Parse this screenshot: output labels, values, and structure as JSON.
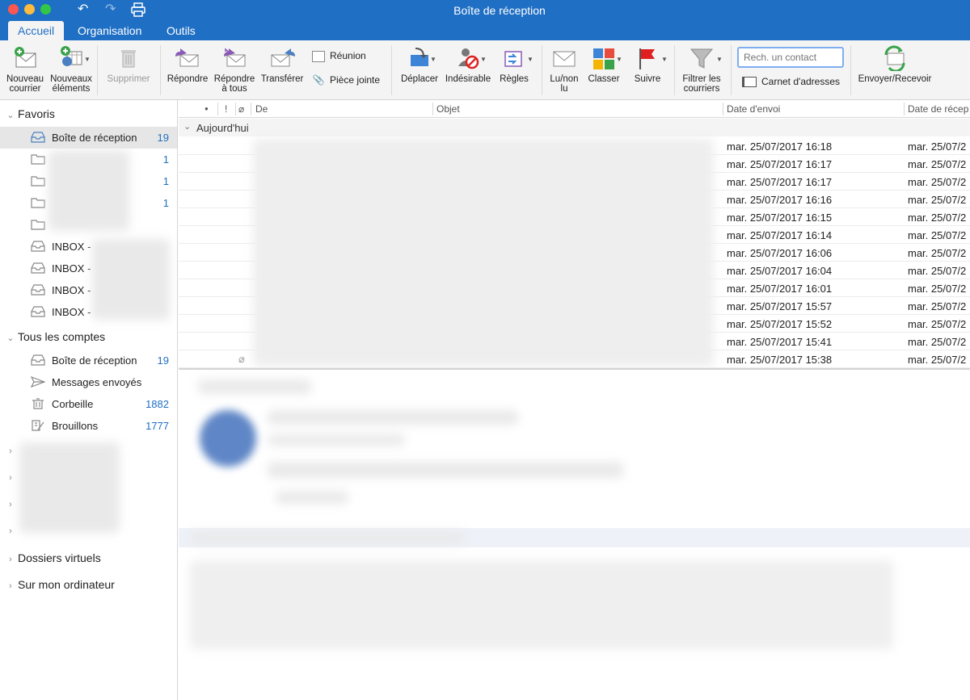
{
  "window": {
    "title": "Boîte de réception"
  },
  "tabs": [
    {
      "label": "Accueil"
    },
    {
      "label": "Organisation"
    },
    {
      "label": "Outils"
    }
  ],
  "ribbon": {
    "new_mail": "Nouveau courrier",
    "new_items": "Nouveaux éléments",
    "delete": "Supprimer",
    "reply": "Répondre",
    "reply_all": "Répondre à tous",
    "forward": "Transférer",
    "meeting": "Réunion",
    "attachment": "Pièce jointe",
    "move": "Déplacer",
    "junk": "Indésirable",
    "rules": "Règles",
    "read_unread": "Lu/non lu",
    "categorize": "Classer",
    "follow_up": "Suivre",
    "filter": "Filtrer les courriers",
    "search_placeholder": "Rech. un contact",
    "address_book": "Carnet d'adresses",
    "send_receive": "Envoyer/Recevoir"
  },
  "sidebar": {
    "favorites": {
      "label": "Favoris",
      "items": [
        {
          "label": "Boîte de réception",
          "count": "19"
        },
        {
          "label": "",
          "count": "1"
        },
        {
          "label": "",
          "count": "1"
        },
        {
          "label": "",
          "count": "1"
        },
        {
          "label": "",
          "count": ""
        },
        {
          "label": "INBOX -",
          "count": ""
        },
        {
          "label": "INBOX -",
          "count": ""
        },
        {
          "label": "INBOX -",
          "count": ""
        },
        {
          "label": "INBOX -",
          "count": ""
        }
      ]
    },
    "all_accounts": {
      "label": "Tous les comptes",
      "items": [
        {
          "label": "Boîte de réception",
          "count": "19"
        },
        {
          "label": "Messages envoyés",
          "count": ""
        },
        {
          "label": "Corbeille",
          "count": "1882"
        },
        {
          "label": "Brouillons",
          "count": "1777"
        }
      ]
    },
    "virtual_folders": "Dossiers virtuels",
    "on_my_computer": "Sur mon ordinateur"
  },
  "list": {
    "columns": {
      "from": "De",
      "subject": "Objet",
      "sent": "Date d'envoi",
      "received": "Date de récep"
    },
    "group": "Aujourd'hui",
    "rows": [
      {
        "sent": "mar. 25/07/2017 16:18",
        "received": "mar. 25/07/2"
      },
      {
        "sent": "mar. 25/07/2017 16:17",
        "received": "mar. 25/07/2"
      },
      {
        "sent": "mar. 25/07/2017 16:17",
        "received": "mar. 25/07/2"
      },
      {
        "sent": "mar. 25/07/2017 16:16",
        "received": "mar. 25/07/2"
      },
      {
        "sent": "mar. 25/07/2017 16:15",
        "received": "mar. 25/07/2"
      },
      {
        "sent": "mar. 25/07/2017 16:14",
        "received": "mar. 25/07/2"
      },
      {
        "sent": "mar. 25/07/2017 16:06",
        "received": "mar. 25/07/2"
      },
      {
        "sent": "mar. 25/07/2017 16:04",
        "received": "mar. 25/07/2"
      },
      {
        "sent": "mar. 25/07/2017 16:01",
        "received": "mar. 25/07/2"
      },
      {
        "sent": "mar. 25/07/2017 15:57",
        "received": "mar. 25/07/2"
      },
      {
        "sent": "mar. 25/07/2017 15:52",
        "received": "mar. 25/07/2"
      },
      {
        "sent": "mar. 25/07/2017 15:41",
        "received": "mar. 25/07/2"
      },
      {
        "sent": "mar. 25/07/2017 15:38",
        "received": "mar. 25/07/2"
      }
    ]
  },
  "colors": {
    "accent": "#1f6fc4",
    "ribbon_bg": "#f4f4f4",
    "selection": "#e6e6e6"
  }
}
